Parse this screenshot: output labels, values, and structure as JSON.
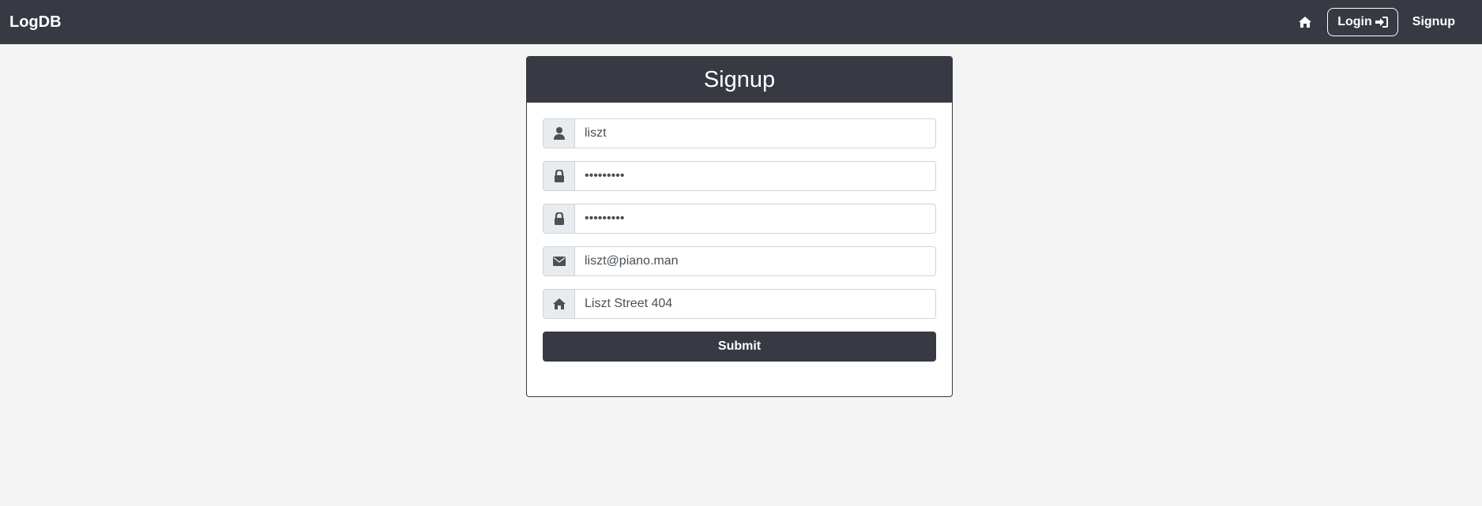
{
  "navbar": {
    "brand": "LogDB",
    "home_icon": "home-icon",
    "login_label": "Login",
    "login_icon": "sign-in-icon",
    "signup_label": "Signup"
  },
  "form": {
    "title": "Signup",
    "fields": [
      {
        "icon": "user-icon",
        "type": "text",
        "value": "liszt"
      },
      {
        "icon": "lock-icon",
        "type": "password",
        "value": "•••••••••"
      },
      {
        "icon": "lock-icon",
        "type": "password",
        "value": "•••••••••"
      },
      {
        "icon": "envelope-icon",
        "type": "email",
        "value": "liszt@piano.man"
      },
      {
        "icon": "home-icon",
        "type": "text",
        "value": "Liszt Street 404"
      }
    ],
    "submit_label": "Submit"
  },
  "colors": {
    "navbar_bg": "#373a43",
    "page_bg": "#f4f4f4",
    "addon_bg": "#e9ecef",
    "text_white": "#ffffff"
  }
}
